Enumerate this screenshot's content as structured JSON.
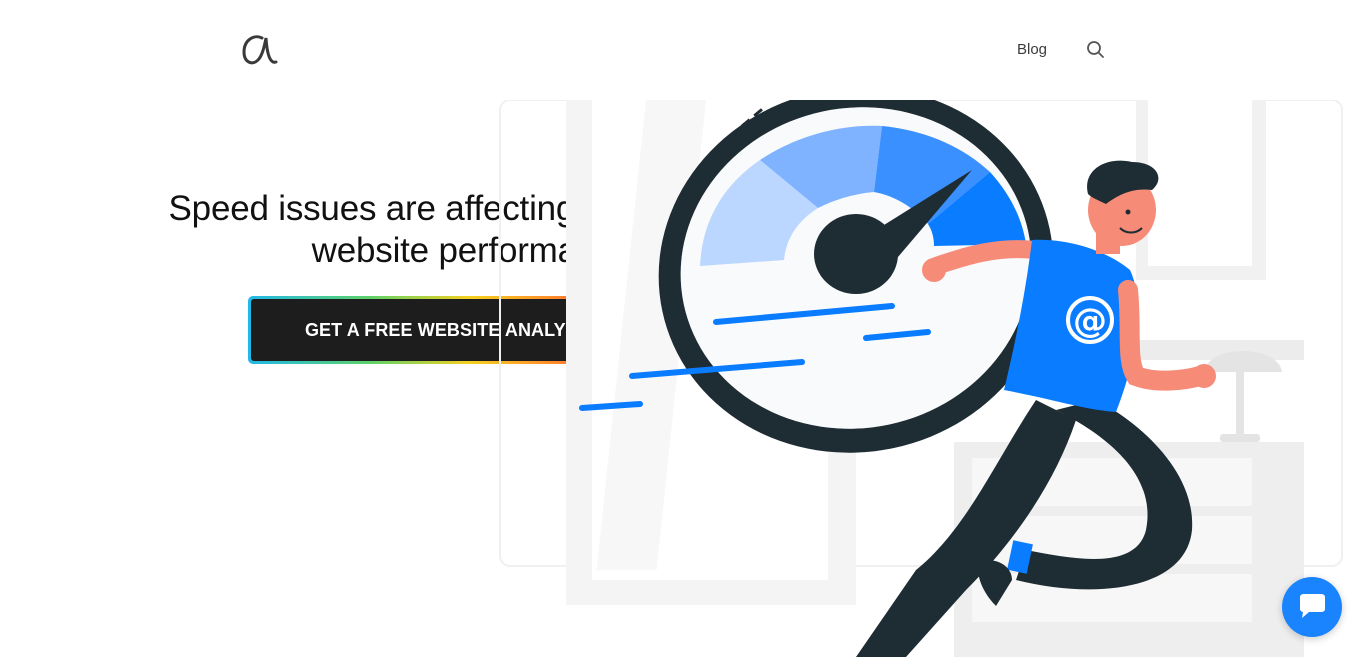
{
  "header": {
    "logo_glyph": "α",
    "nav_blog": "Blog",
    "search_icon": "search-icon"
  },
  "hero": {
    "title_line1": "Speed issues are affecting your",
    "title_line2": "website performance?",
    "cta_label": "GET A FREE WEBSITE ANALYSIS"
  },
  "illustration": {
    "subject": "running-man-with-speedometer",
    "shirt_symbol": "@"
  },
  "chat": {
    "icon": "chat-bubble-icon"
  },
  "colors": {
    "accent_blue": "#0a7cff",
    "dark_navy": "#1e2c33",
    "skin": "#f68b78",
    "cta_bg": "#1d1d1d"
  }
}
